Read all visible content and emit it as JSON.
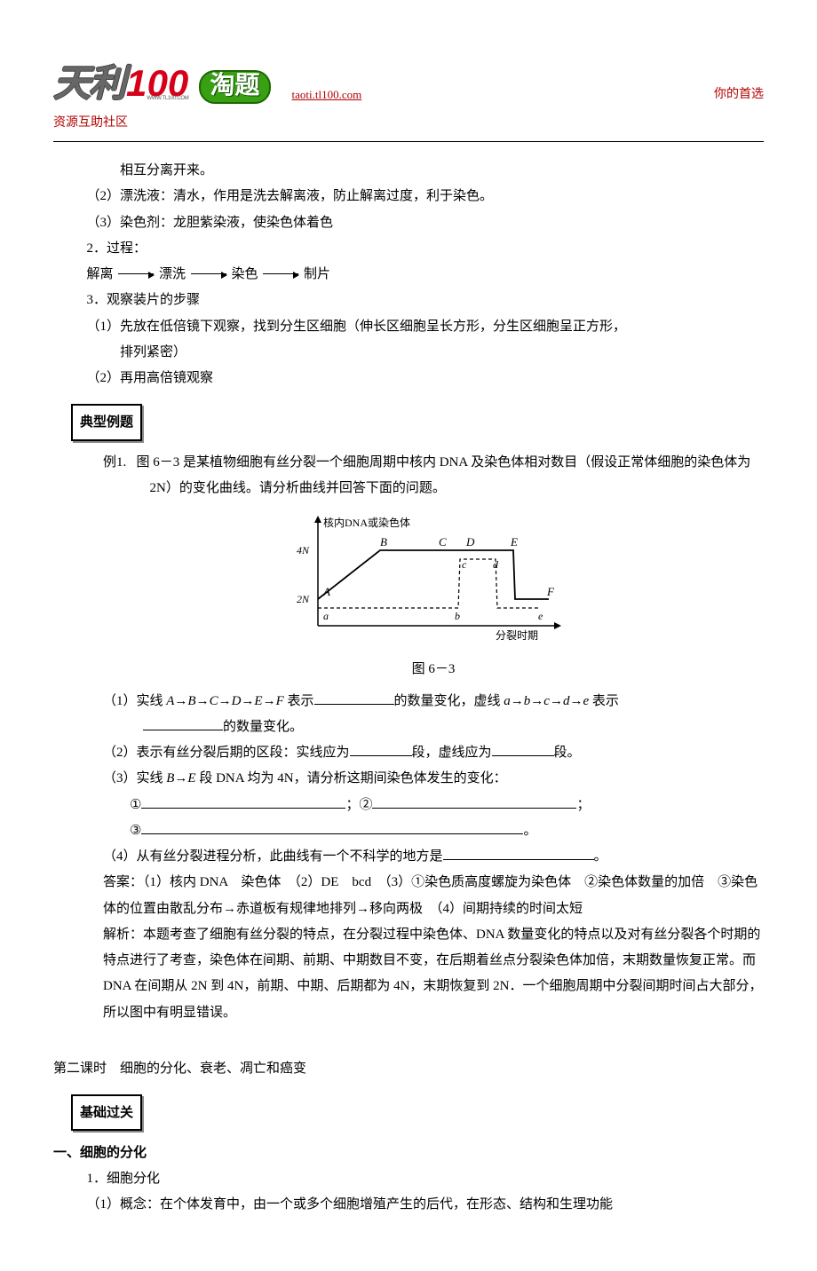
{
  "header": {
    "logo_cn": "天利",
    "logo_num_1": "1",
    "logo_num_00": "00",
    "logo_small_url": "WWW.TL100.COM",
    "taoti": "淘题",
    "url": "taoti.tl100.com",
    "right": "你的首选",
    "subtitle": "资源互助社区"
  },
  "top": {
    "l0": "相互分离开来。",
    "l1": "（2）漂洗液：清水，作用是洗去解离液，防止解离过度，利于染色。",
    "l2": "（3）染色剂：龙胆紫染液，使染色体着色",
    "l3": "2．过程：",
    "proc_a": "解离",
    "proc_b": "漂洗",
    "proc_c": "染色",
    "proc_d": "制片",
    "l4": "3．观察装片的步骤",
    "l5a": "（1）先放在低倍镜下观察，找到分生区细胞（伸长区细胞呈长方形，分生区细胞呈正方形，",
    "l5b": "排列紧密）",
    "l6": "（2）再用高倍镜观察"
  },
  "tag_example": "典型例题",
  "example": {
    "label": "例1.",
    "p1": "图 6－3 是某植物细胞有丝分裂一个细胞周期中核内 DNA 及染色体相对数目（假设正常体细胞的染色体为 2N）的变化曲线。请分析曲线并回答下面的问题。",
    "caption": "图 6－3",
    "q1a": "（1）实线 ",
    "q1b": "A→B→C→D→E→F",
    "q1c": " 表示",
    "q1d": "的数量变化，虚线 ",
    "q1e": "a→b→c→d→e",
    "q1f": " 表示",
    "q1g": "的数量变化。",
    "q2a": "（2）表示有丝分裂后期的区段：实线应为",
    "q2b": "段，虚线应为",
    "q2c": "段。",
    "q3a": "（3）实线 ",
    "q3b": "B→E",
    "q3c": " 段 DNA 均为 4N，请分析这期间染色体发生的变化：",
    "q3_1": "①",
    "q3_2": "；②",
    "q3_3": "；",
    "q3_4": "③",
    "q3_5": "。",
    "q4a": "（4）从有丝分裂进程分析，此曲线有一个不科学的地方是",
    "q4b": "。",
    "ans": "答案：（1）核内 DNA　染色体　（2）DE　bcd　（3）①染色质高度螺旋为染色体　②染色体数量的加倍　③染色体的位置由散乱分布→赤道板有规律地排列→移向两极　（4）间期持续的时间太短",
    "exp": "解析：本题考查了细胞有丝分裂的特点，在分裂过程中染色体、DNA 数量变化的特点以及对有丝分裂各个时期的特点进行了考查，染色体在间期、前期、中期数目不变，在后期着丝点分裂染色体加倍，末期数量恢复正常。而 DNA 在间期从 2N 到 4N，前期、中期、后期都为 4N，末期恢复到 2N．一个细胞周期中分裂间期时间占大部分，所以图中有明显错误。"
  },
  "lesson2_title": "第二课时　细胞的分化、衰老、凋亡和癌变",
  "tag_basics": "基础过关",
  "sectionA": {
    "h": "一、细胞的分化",
    "l1": "1．细胞分化",
    "l2": "（1）概念：在个体发育中，由一个或多个细胞增殖产生的后代，在形态、结构和生理功能"
  },
  "chart_data": {
    "type": "line",
    "title": "",
    "xlabel": "分裂时期",
    "ylabel": "核内DNA或染色体",
    "yticks": [
      "2N",
      "4N"
    ],
    "series": [
      {
        "name": "solid",
        "label_points": [
          "A",
          "B",
          "C",
          "D",
          "E",
          "F"
        ],
        "points": [
          {
            "x": 0,
            "y": 2,
            "label": "A"
          },
          {
            "x": 70,
            "y": 4,
            "label": "B"
          },
          {
            "x": 140,
            "y": 4,
            "label": "C"
          },
          {
            "x": 170,
            "y": 4,
            "label": "D"
          },
          {
            "x": 220,
            "y": 4,
            "label": "E"
          },
          {
            "x": 222,
            "y": 2,
            "label": ""
          },
          {
            "x": 260,
            "y": 2,
            "label": "F"
          }
        ]
      },
      {
        "name": "dashed",
        "label_points": [
          "a",
          "b",
          "c",
          "d",
          "e"
        ],
        "points": [
          {
            "x": 0,
            "y": 2,
            "label": "a"
          },
          {
            "x": 160,
            "y": 2,
            "label": "b"
          },
          {
            "x": 162,
            "y": 4,
            "label": "c"
          },
          {
            "x": 200,
            "y": 4,
            "label": "d"
          },
          {
            "x": 202,
            "y": 2,
            "label": ""
          },
          {
            "x": 250,
            "y": 2,
            "label": "e"
          }
        ]
      }
    ],
    "ylim": [
      0,
      4.5
    ]
  }
}
